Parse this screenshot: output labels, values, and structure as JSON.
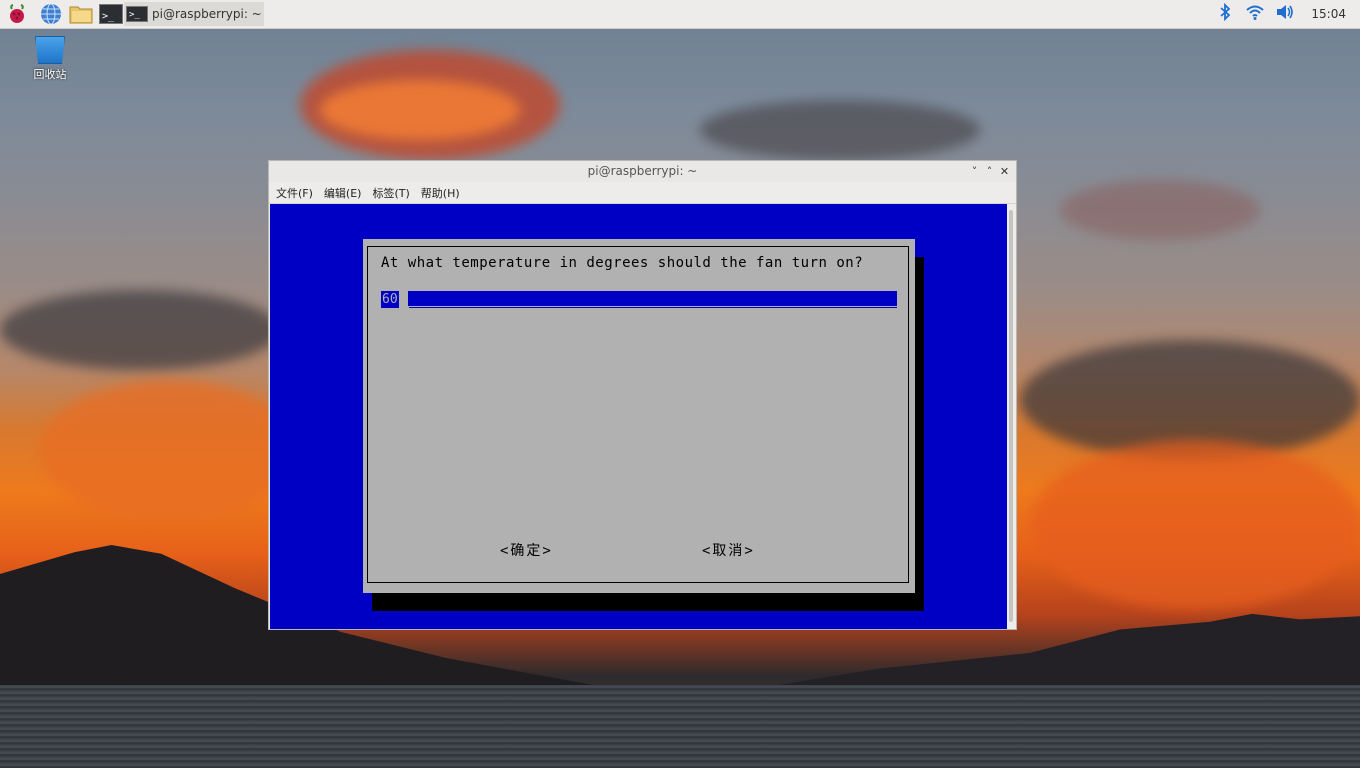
{
  "panel": {
    "taskbar_item_title": "pi@raspberrypi: ~",
    "clock": "15:04",
    "icons": [
      "raspberry-menu-icon",
      "browser-globe-icon",
      "file-manager-icon",
      "terminal-icon",
      "bluetooth-icon",
      "wifi-icon",
      "volume-icon"
    ]
  },
  "desktop": {
    "trash_label": "回收站"
  },
  "terminal": {
    "title": "pi@raspberrypi: ~",
    "menu": [
      "文件(F)",
      "编辑(E)",
      "标签(T)",
      "帮助(H)"
    ],
    "window_controls": [
      "˅",
      "˄",
      "✕"
    ]
  },
  "dialog": {
    "prompt": "At what temperature in degrees should the fan turn on?",
    "input_value": "60",
    "ok_label": "<确定>",
    "cancel_label": "<取消>"
  },
  "colors": {
    "terminal_bg": "#0000c4",
    "dialog_bg": "#b1b1b1",
    "panel_bg": "#edeceb"
  }
}
